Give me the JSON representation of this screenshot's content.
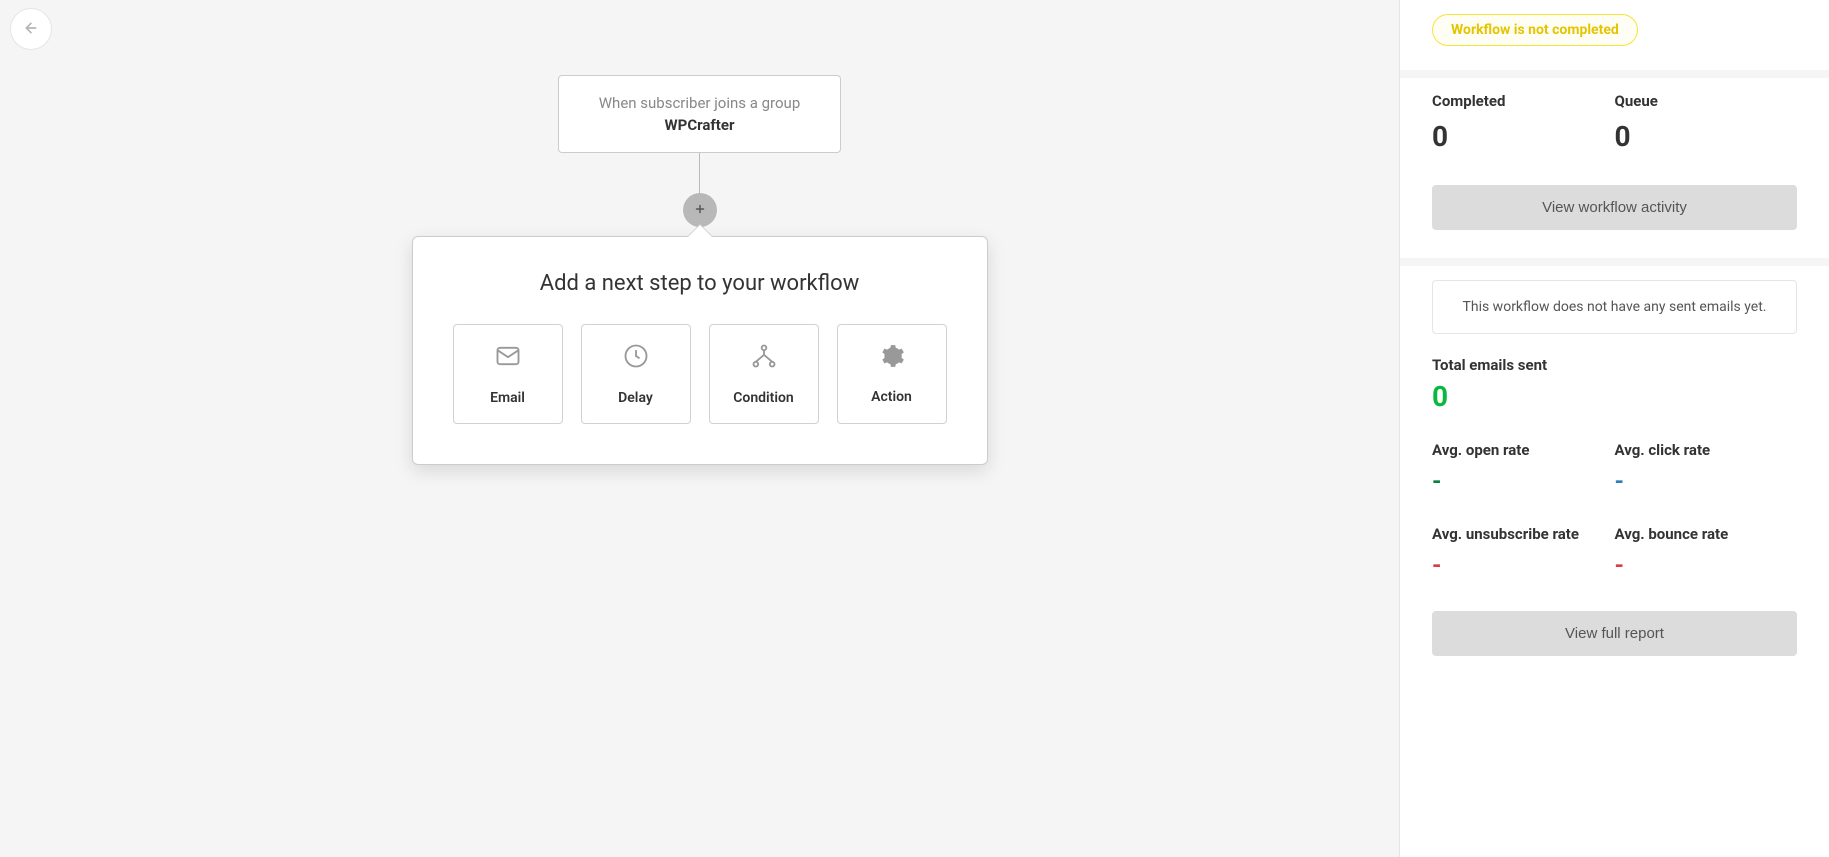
{
  "trigger": {
    "title": "When subscriber joins a group",
    "group": "WPCrafter"
  },
  "next_step": {
    "title": "Add a next step to your workflow",
    "options": [
      {
        "label": "Email"
      },
      {
        "label": "Delay"
      },
      {
        "label": "Condition"
      },
      {
        "label": "Action"
      }
    ]
  },
  "sidebar": {
    "status_text": "Workflow is not completed",
    "stats": {
      "completed_label": "Completed",
      "completed_value": "0",
      "queue_label": "Queue",
      "queue_value": "0"
    },
    "view_activity_label": "View workflow activity",
    "no_emails_text": "This workflow does not have any sent emails yet.",
    "total_sent_label": "Total emails sent",
    "total_sent_value": "0",
    "rates": {
      "open_label": "Avg. open rate",
      "open_value": "-",
      "click_label": "Avg. click rate",
      "click_value": "-",
      "unsub_label": "Avg. unsubscribe rate",
      "unsub_value": "-",
      "bounce_label": "Avg. bounce rate",
      "bounce_value": "-"
    },
    "view_report_label": "View full report"
  }
}
